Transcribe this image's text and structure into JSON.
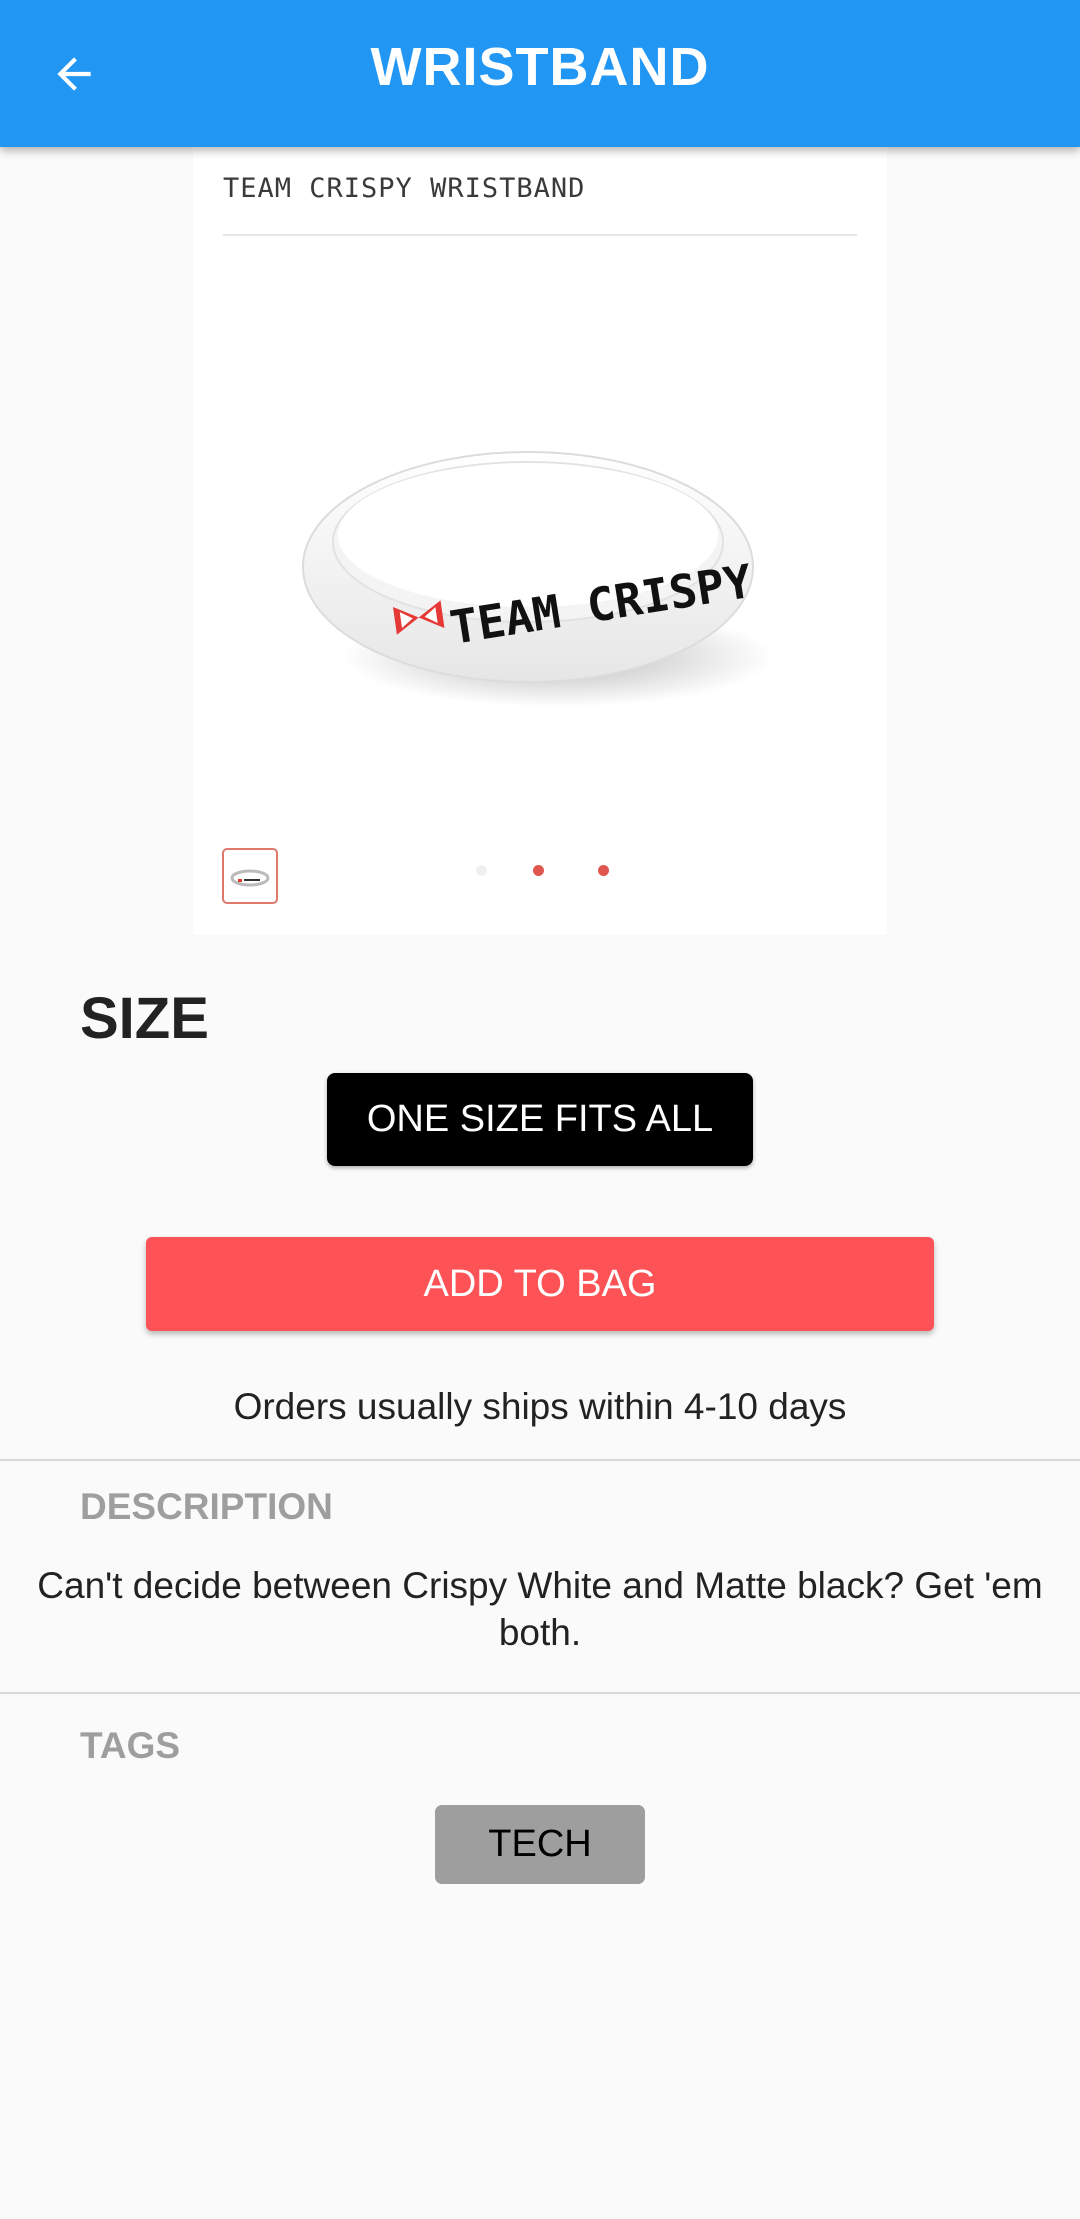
{
  "app_bar": {
    "title": "WRISTBAND",
    "back_icon": "arrow-back-icon",
    "background_color": "#2196f3"
  },
  "product_card": {
    "title": "TEAM CRISPY WRISTBAND",
    "image_text": "TEAM CRISPY",
    "image_count": 3,
    "selected_image": 1
  },
  "size": {
    "label": "SIZE",
    "selected_option": "ONE SIZE FITS ALL"
  },
  "actions": {
    "add_to_bag_label": "ADD TO BAG",
    "add_to_bag_color": "#fe5356"
  },
  "shipping": {
    "note": "Orders usually ships within 4-10 days"
  },
  "description": {
    "label": "DESCRIPTION",
    "text": "Can't decide between Crispy White and Matte black? Get 'em\nboth."
  },
  "tags": {
    "label": "TAGS",
    "items": [
      "TECH"
    ]
  }
}
